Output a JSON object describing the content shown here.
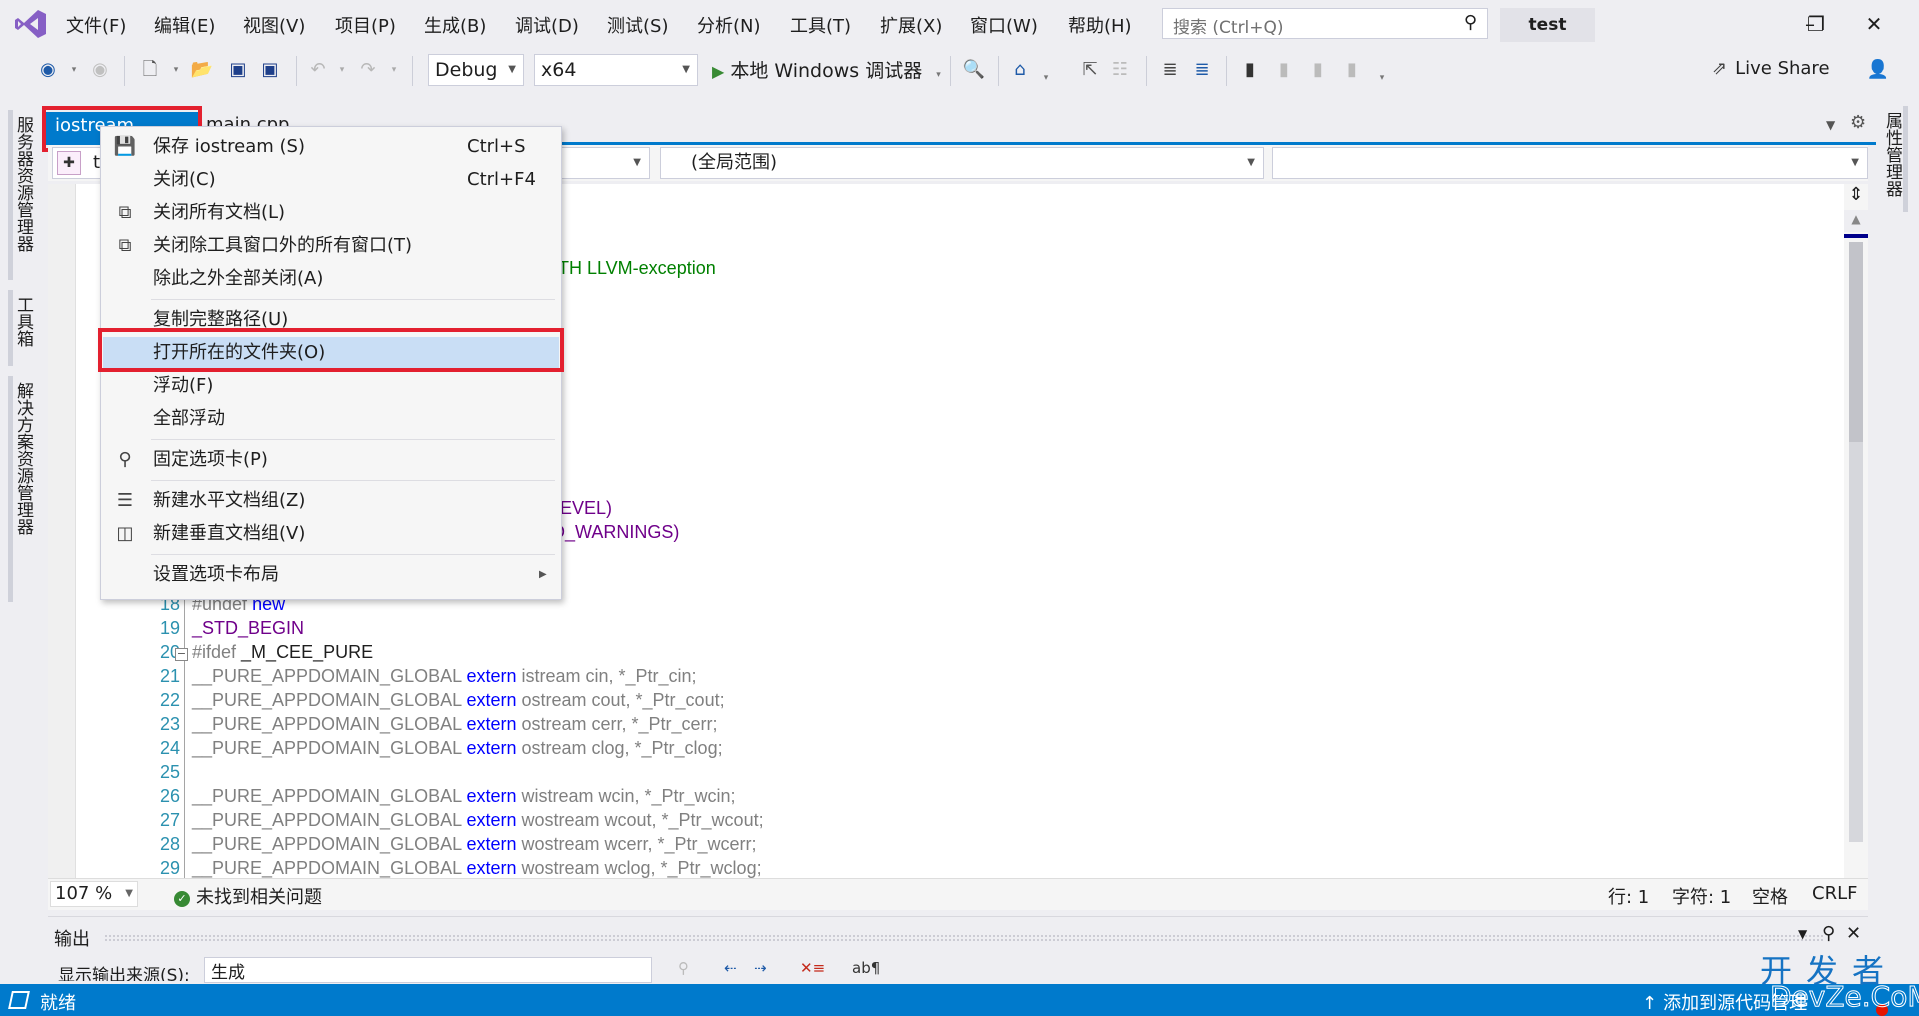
{
  "menubar": {
    "items": [
      "文件(F)",
      "编辑(E)",
      "视图(V)",
      "项目(P)",
      "生成(B)",
      "调试(D)",
      "测试(S)",
      "分析(N)",
      "工具(T)",
      "扩展(X)",
      "窗口(W)",
      "帮助(H)"
    ],
    "search_placeholder": "搜索 (Ctrl+Q)",
    "solution_name": "test",
    "window_buttons": {
      "minimize": "–",
      "restore": "❐",
      "close": "✕"
    }
  },
  "toolbar": {
    "configuration": "Debug",
    "platform": "x64",
    "run_label": "本地 Windows 调试器",
    "live_share": "Live Share"
  },
  "left_rail": {
    "tabs": [
      "服务器资源管理器",
      "工具箱",
      "解决方案资源管理器"
    ]
  },
  "right_rail": {
    "tabs": [
      "属性管理器"
    ]
  },
  "doc_tabs": {
    "active": "iostream",
    "active_close": "✕",
    "inactive": "main.cpp"
  },
  "navbar": {
    "project_combo": "t",
    "scope_combo": "(全局范围)",
    "member_combo": ""
  },
  "editor": {
    "visible_fragments": [
      {
        "text": "TH LLVM-exception",
        "cls": "c-comment"
      },
      {
        "text": "EVEL)",
        "cls": "c-macro"
      },
      {
        "text": "D_WARNINGS)",
        "cls": "c-macro"
      }
    ],
    "lines": [
      {
        "n": "18",
        "parts": [
          {
            "t": "#undef ",
            "c": "c-gray"
          },
          {
            "t": "new",
            "c": "c-kw"
          }
        ]
      },
      {
        "n": "19",
        "parts": [
          {
            "t": "_STD_BEGIN",
            "c": "c-macro"
          }
        ]
      },
      {
        "n": "20",
        "parts": [
          {
            "t": "#ifdef ",
            "c": "c-gray"
          },
          {
            "t": "_M_CEE_PURE",
            "c": "c-plain"
          }
        ]
      },
      {
        "n": "21",
        "parts": [
          {
            "t": "__PURE_APPDOMAIN_GLOBAL ",
            "c": "c-gray"
          },
          {
            "t": "extern ",
            "c": "c-kw"
          },
          {
            "t": "istream cin, *_Ptr_cin;",
            "c": "c-gray"
          }
        ]
      },
      {
        "n": "22",
        "parts": [
          {
            "t": "__PURE_APPDOMAIN_GLOBAL ",
            "c": "c-gray"
          },
          {
            "t": "extern ",
            "c": "c-kw"
          },
          {
            "t": "ostream cout, *_Ptr_cout;",
            "c": "c-gray"
          }
        ]
      },
      {
        "n": "23",
        "parts": [
          {
            "t": "__PURE_APPDOMAIN_GLOBAL ",
            "c": "c-gray"
          },
          {
            "t": "extern ",
            "c": "c-kw"
          },
          {
            "t": "ostream cerr, *_Ptr_cerr;",
            "c": "c-gray"
          }
        ]
      },
      {
        "n": "24",
        "parts": [
          {
            "t": "__PURE_APPDOMAIN_GLOBAL ",
            "c": "c-gray"
          },
          {
            "t": "extern ",
            "c": "c-kw"
          },
          {
            "t": "ostream clog, *_Ptr_clog;",
            "c": "c-gray"
          }
        ]
      },
      {
        "n": "25",
        "parts": []
      },
      {
        "n": "26",
        "parts": [
          {
            "t": "__PURE_APPDOMAIN_GLOBAL ",
            "c": "c-gray"
          },
          {
            "t": "extern ",
            "c": "c-kw"
          },
          {
            "t": "wistream wcin, *_Ptr_wcin;",
            "c": "c-gray"
          }
        ]
      },
      {
        "n": "27",
        "parts": [
          {
            "t": "__PURE_APPDOMAIN_GLOBAL ",
            "c": "c-gray"
          },
          {
            "t": "extern ",
            "c": "c-kw"
          },
          {
            "t": "wostream wcout, *_Ptr_wcout;",
            "c": "c-gray"
          }
        ]
      },
      {
        "n": "28",
        "parts": [
          {
            "t": "__PURE_APPDOMAIN_GLOBAL ",
            "c": "c-gray"
          },
          {
            "t": "extern ",
            "c": "c-kw"
          },
          {
            "t": "wostream wcerr, *_Ptr_wcerr;",
            "c": "c-gray"
          }
        ]
      },
      {
        "n": "29",
        "parts": [
          {
            "t": "__PURE_APPDOMAIN_GLOBAL ",
            "c": "c-gray"
          },
          {
            "t": "extern ",
            "c": "c-kw"
          },
          {
            "t": "wostream wclog, *_Ptr_wclog;",
            "c": "c-gray"
          }
        ]
      }
    ]
  },
  "editor_status": {
    "zoom": "107 %",
    "issues": "未找到相关问题",
    "line": "行: 1",
    "char": "字符: 1",
    "whitespace": "空格",
    "line_ending": "CRLF"
  },
  "output_panel": {
    "title": "输出",
    "source_label": "显示输出来源(S):",
    "source_value": "生成"
  },
  "context_menu": {
    "items": [
      {
        "label": "保存 iostream (S)",
        "shortcut": "Ctrl+S",
        "icon": "save-icon",
        "glyph": "💾"
      },
      {
        "label": "关闭(C)",
        "shortcut": "Ctrl+F4",
        "icon": "",
        "glyph": ""
      },
      {
        "label": "关闭所有文档(L)",
        "shortcut": "",
        "icon": "close-all-documents-icon",
        "glyph": "⧉"
      },
      {
        "label": "关闭除工具窗口外的所有窗口(T)",
        "shortcut": "",
        "icon": "close-all-but-tool-windows-icon",
        "glyph": "⧉"
      },
      {
        "label": "除此之外全部关闭(A)",
        "shortcut": "",
        "icon": "",
        "glyph": ""
      },
      {
        "label": "复制完整路径(U)",
        "shortcut": "",
        "icon": "",
        "glyph": ""
      },
      {
        "label": "打开所在的文件夹(O)",
        "shortcut": "",
        "icon": "",
        "glyph": "",
        "highlighted": true
      },
      {
        "label": "浮动(F)",
        "shortcut": "",
        "icon": "",
        "glyph": ""
      },
      {
        "label": "全部浮动",
        "shortcut": "",
        "icon": "",
        "glyph": ""
      },
      {
        "label": "固定选项卡(P)",
        "shortcut": "",
        "icon": "pin-icon",
        "glyph": "⚲"
      },
      {
        "label": "新建水平文档组(Z)",
        "shortcut": "",
        "icon": "horizontal-group-icon",
        "glyph": "☰"
      },
      {
        "label": "新建垂直文档组(V)",
        "shortcut": "",
        "icon": "vertical-group-icon",
        "glyph": "◫"
      },
      {
        "label": "设置选项卡布局",
        "shortcut": "",
        "icon": "",
        "glyph": "",
        "submenu": true
      }
    ]
  },
  "statusbar": {
    "ready": "就绪",
    "source_control": "添加到源代码管理"
  },
  "watermark": {
    "line1": "开发者",
    "line2": "DevZe.CoM"
  },
  "colors": {
    "accent": "#007acc",
    "highlight": "#c9def5",
    "annotation_red": "#e3202f"
  }
}
